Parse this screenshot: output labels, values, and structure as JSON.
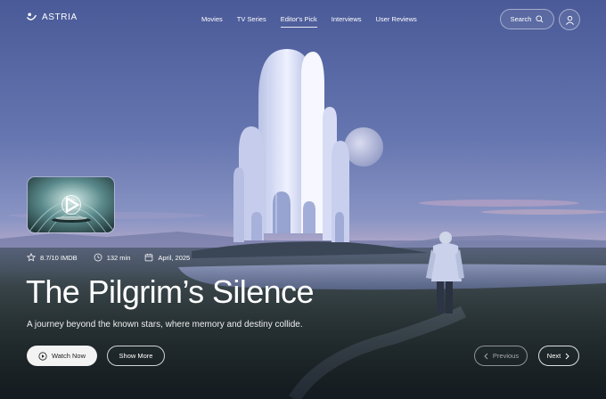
{
  "brand": {
    "name": "ASTRIA"
  },
  "nav": {
    "items": [
      {
        "label": "Movies",
        "active": false
      },
      {
        "label": "TV Series",
        "active": false
      },
      {
        "label": "Editor's Pick",
        "active": true
      },
      {
        "label": "Interviews",
        "active": false
      },
      {
        "label": "User Reviews",
        "active": false
      }
    ],
    "search_label": "Search",
    "search_icon": "search-icon",
    "user_icon": "user-icon"
  },
  "movie": {
    "rating": "8.7/10 IMDB",
    "duration": "132 min",
    "release": "April, 2025",
    "title": "The Pilgrim’s Silence",
    "tagline": "A journey beyond the known stars, where memory and destiny collide."
  },
  "actions": {
    "watch_label": "Watch Now",
    "more_label": "Show More",
    "prev_label": "Previous",
    "next_label": "Next"
  },
  "colors": {
    "sky_top": "#4a5c9a",
    "sky_mid": "#7f8ec0",
    "horizon": "#b8a3c0",
    "ground": "#2e3a33",
    "button_light": "#f3f3f3"
  }
}
